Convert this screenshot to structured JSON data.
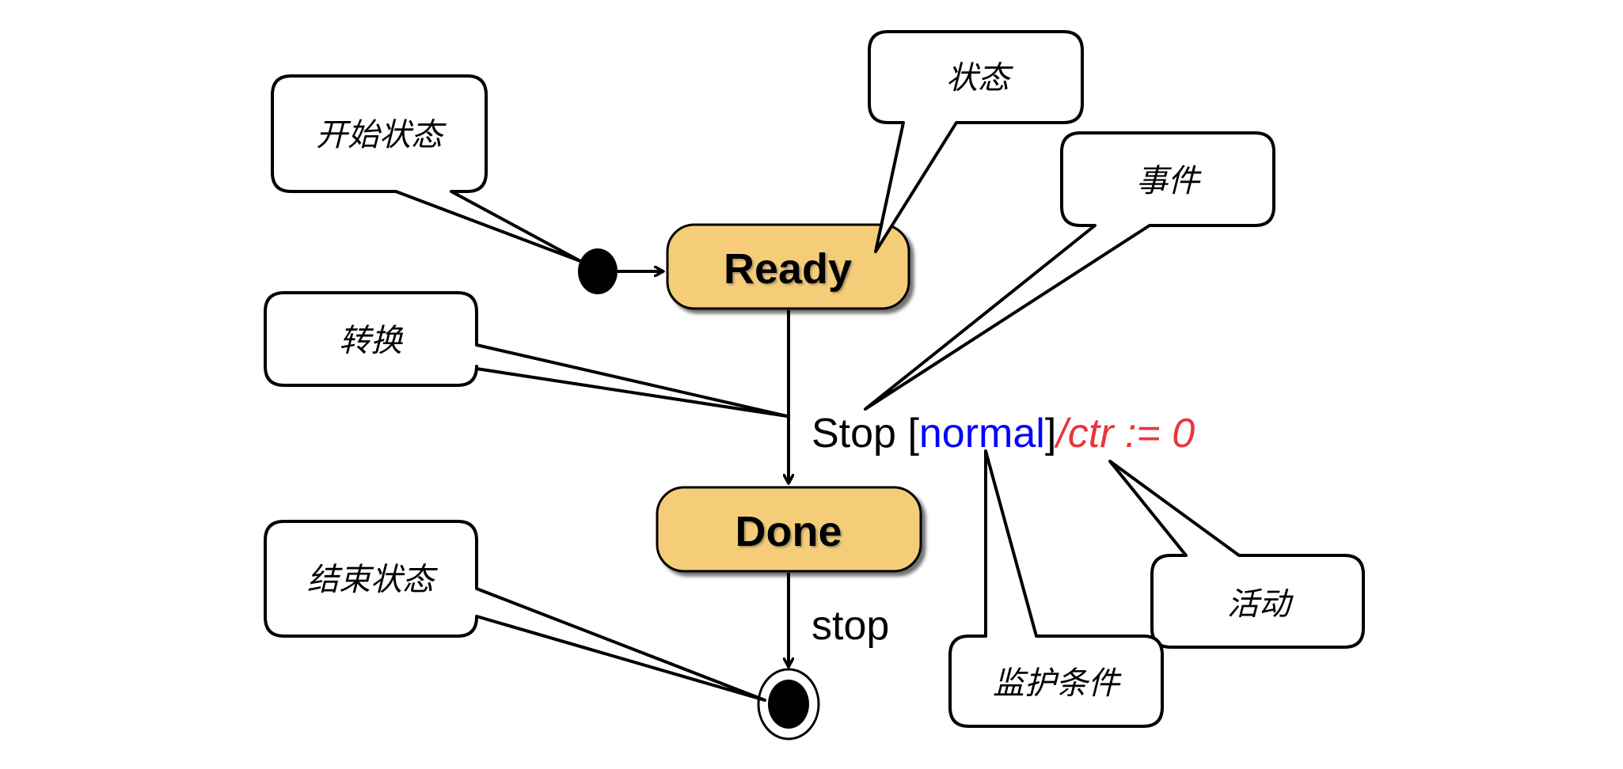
{
  "diagram": {
    "type": "UML state machine",
    "states": [
      {
        "id": "ready",
        "label": "Ready"
      },
      {
        "id": "done",
        "label": "Done"
      }
    ],
    "pseudostates": {
      "initial": "initial-state",
      "final": "final-state"
    },
    "transitions": [
      {
        "from": "initial",
        "to": "ready",
        "label": ""
      },
      {
        "from": "ready",
        "to": "done",
        "event": "Stop",
        "guard_open": "[",
        "guard": "normal",
        "guard_close": "]",
        "action": "/ctr := 0"
      },
      {
        "from": "done",
        "to": "final",
        "label": "stop"
      }
    ],
    "callouts": {
      "start_state": "开始状态",
      "state": "状态",
      "event": "事件",
      "transition": "转换",
      "end_state": "结束状态",
      "activity": "活动",
      "guard_condition": "监护条件"
    },
    "colors": {
      "state_fill": "#F5CD78",
      "guard": "#0000FF",
      "action": "#E8373C",
      "text": "#000000"
    }
  }
}
